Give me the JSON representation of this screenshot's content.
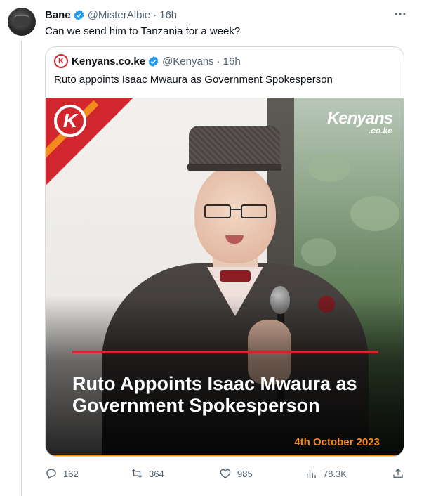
{
  "tweet": {
    "author_name": "Bane",
    "handle": "@MisterAlbie",
    "separator": "·",
    "time": "16h",
    "text": "Can we send him to Tanzania for a week?"
  },
  "quote": {
    "author_name": "Kenyans.co.ke",
    "handle": "@Kenyans",
    "separator": "·",
    "time": "16h",
    "text": "Ruto appoints Isaac Mwaura as Government Spokesperson",
    "logo_letter": "K",
    "media": {
      "logo_letter": "K",
      "watermark_main": "Kenyans",
      "watermark_sub": ".co.ke",
      "headline": "Ruto Appoints Isaac Mwaura as Government Spokesperson",
      "date": "4th October 2023"
    }
  },
  "actions": {
    "reply_count": "162",
    "retweet_count": "364",
    "like_count": "985",
    "view_count": "78.3K"
  },
  "colors": {
    "verified_blue": "#1d9bf0",
    "brand_red": "#d1262e",
    "brand_orange": "#f28a1e",
    "muted": "#536471"
  }
}
